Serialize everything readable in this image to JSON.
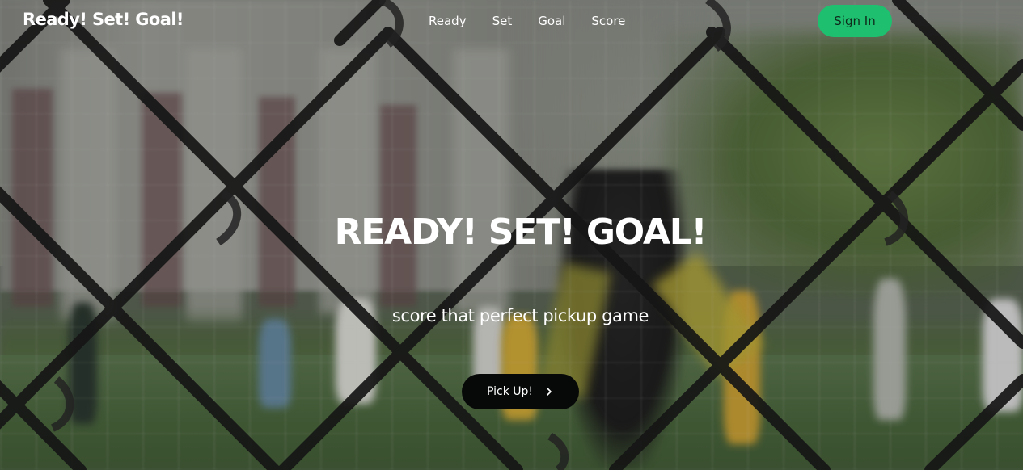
{
  "navbar": {
    "brand": "Ready! Set! Goal!",
    "links": [
      {
        "label": "Ready"
      },
      {
        "label": "Set"
      },
      {
        "label": "Goal"
      },
      {
        "label": "Score"
      }
    ],
    "sign_in_label": "Sign In"
  },
  "hero": {
    "title": "READY! SET! GOAL!",
    "subtitle": "score that perfect pickup game",
    "cta_label": "Pick Up!",
    "cta_icon": "chevron-right-icon",
    "background_image": "soccer-pitch-behind-chain-link-fence"
  },
  "colors": {
    "accent": "#1ec06f",
    "cta_background": "#070909",
    "text": "#ffffff"
  }
}
